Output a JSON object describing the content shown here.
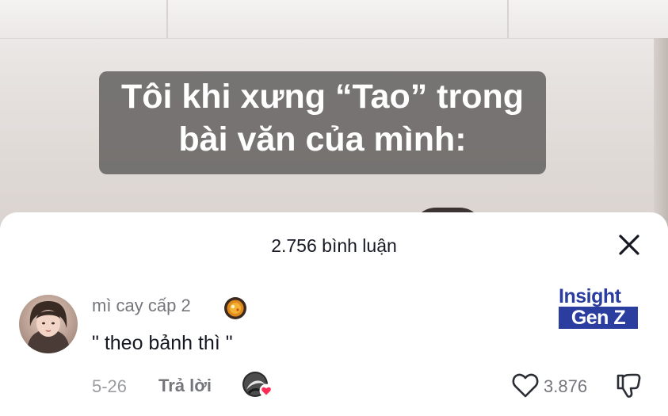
{
  "video": {
    "caption_line1": "Tôi khi xưng “Tao” trong",
    "caption_line2": "bài văn của mình:"
  },
  "comments_sheet": {
    "title": "2.756 bình luận",
    "close_icon": "close-icon"
  },
  "comment": {
    "username": "mì cay cấp 2",
    "username_emoji": "pan-food-icon",
    "text": "\" theo bảnh thì \"",
    "date": "5-26",
    "reply_label": "Trả lời",
    "like_count": "3.876",
    "like_icon": "heart-outline-icon",
    "dislike_icon": "thumbs-down-icon",
    "creator_liked_icon": "creator-liked-avatar-icon"
  },
  "watermark": {
    "line1": "Insight",
    "line2": "Gen Z"
  },
  "colors": {
    "text_primary": "#161823",
    "text_secondary": "#75767c",
    "like_heart_badge": "#fe2c55",
    "watermark_blue": "#2b3ea0"
  }
}
